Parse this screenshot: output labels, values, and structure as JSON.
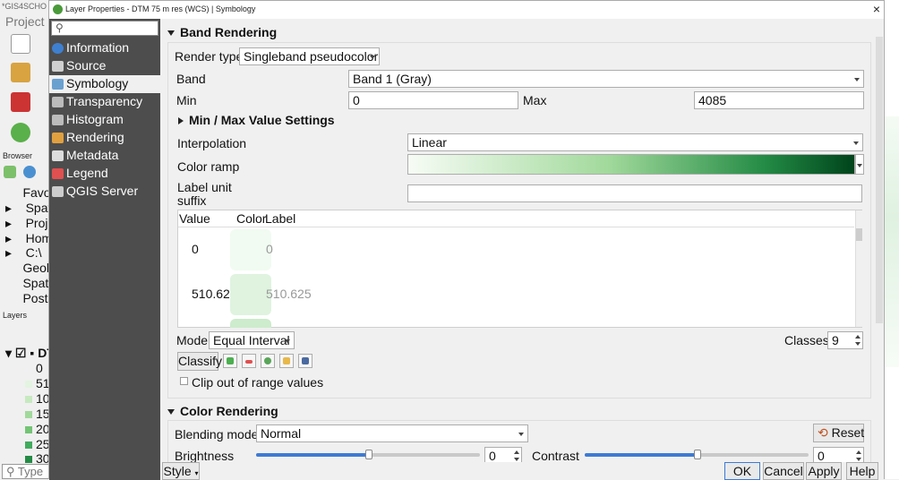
{
  "background_app": {
    "title": "*GIS4SCHO",
    "menu_project": "Project",
    "browser_label": "Browser",
    "layers_label": "Layers",
    "browser_items": [
      "Favo",
      "Spat",
      "Proj",
      "Hom",
      "C:\\",
      "Geol",
      "Spat",
      "Post"
    ],
    "layer_name": "DT",
    "legend_values": [
      "0",
      "51",
      "10",
      "15",
      "20",
      "25",
      "30"
    ],
    "search_placeholder": "Type"
  },
  "dialog": {
    "title": "Layer Properties - DTM 75 m res (WCS) | Symbology",
    "close": "×"
  },
  "sidebar": {
    "items": [
      {
        "label": "Information",
        "icon": "info-icon",
        "color": "#3f7fd0"
      },
      {
        "label": "Source",
        "icon": "source-icon",
        "color": "#cfcfcf"
      },
      {
        "label": "Symbology",
        "icon": "symbology-icon",
        "color": "#6aa0d0"
      },
      {
        "label": "Transparency",
        "icon": "transparency-icon",
        "color": "#bbbbbb"
      },
      {
        "label": "Histogram",
        "icon": "histogram-icon",
        "color": "#bbbbbb"
      },
      {
        "label": "Rendering",
        "icon": "rendering-icon",
        "color": "#e0a040"
      },
      {
        "label": "Metadata",
        "icon": "metadata-icon",
        "color": "#dddddd"
      },
      {
        "label": "Legend",
        "icon": "legend-icon",
        "color": "#e05050"
      },
      {
        "label": "QGIS Server",
        "icon": "server-icon",
        "color": "#cccccc"
      }
    ]
  },
  "band_rendering": {
    "header": "Band Rendering",
    "render_type_label": "Render type",
    "render_type_value": "Singleband pseudocolor",
    "band_label": "Band",
    "band_value": "Band 1 (Gray)",
    "min_label": "Min",
    "min_value": "0",
    "max_label": "Max",
    "max_value": "4085",
    "minmax_header": "Min / Max Value Settings",
    "interpolation_label": "Interpolation",
    "interpolation_value": "Linear",
    "color_ramp_label": "Color ramp",
    "label_unit_label1": "Label unit",
    "label_unit_label2": "suffix",
    "label_unit_value": "",
    "table_headers": {
      "value": "Value",
      "color": "Color",
      "label": "Label"
    },
    "table_rows": [
      {
        "value": "0",
        "label": "0",
        "color": "#f1fbf1"
      },
      {
        "value": "510.625",
        "label": "510.625",
        "color": "#dff3df"
      },
      {
        "value": "",
        "label": "",
        "color": "#cdebcd"
      }
    ],
    "mode_label": "Mode",
    "mode_value": "Equal Interval",
    "classes_label": "Classes",
    "classes_value": "9",
    "classify_button": "Classify",
    "clip_label": "Clip out of range values"
  },
  "color_rendering": {
    "header": "Color Rendering",
    "blending_label": "Blending mode",
    "blending_value": "Normal",
    "reset_button": "Reset",
    "brightness_label": "Brightness",
    "brightness_value": "0",
    "contrast_label": "Contrast",
    "contrast_value": "0"
  },
  "bottom": {
    "style_button": "Style",
    "ok": "OK",
    "cancel": "Cancel",
    "apply": "Apply",
    "help": "Help"
  },
  "colors": {
    "ramp_start": "#f7fcf5",
    "ramp_end": "#00441b",
    "slider_fill": "#3d7ad6"
  }
}
